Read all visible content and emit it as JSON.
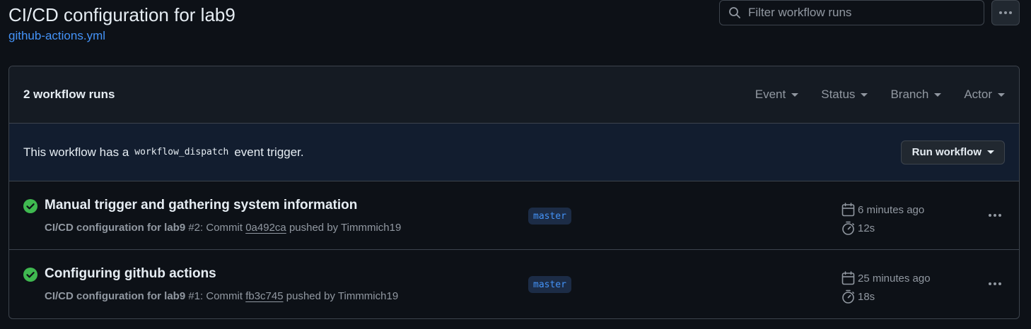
{
  "header": {
    "title": "CI/CD configuration for lab9",
    "file_link": "github-actions.yml"
  },
  "search": {
    "placeholder": "Filter workflow runs",
    "value": ""
  },
  "runs_box": {
    "count_label": "2 workflow runs",
    "filters": [
      "Event",
      "Status",
      "Branch",
      "Actor"
    ]
  },
  "dispatch": {
    "prefix": "This workflow has a",
    "code": "workflow_dispatch",
    "suffix": "event trigger.",
    "button_label": "Run workflow"
  },
  "runs": [
    {
      "title": "Manual trigger and gathering system information",
      "workflow": "CI/CD configuration for lab9",
      "run_number": "#2",
      "commit_prefix": ": Commit",
      "commit_sha": "0a492ca",
      "pushed_by": "pushed by Timmmich19",
      "branch": "master",
      "time_ago": "6 minutes ago",
      "duration": "12s",
      "status": "success"
    },
    {
      "title": "Configuring github actions",
      "workflow": "CI/CD configuration for lab9",
      "run_number": "#1",
      "commit_prefix": ": Commit",
      "commit_sha": "fb3c745",
      "pushed_by": "pushed by Timmmich19",
      "branch": "master",
      "time_ago": "25 minutes ago",
      "duration": "18s",
      "status": "success"
    }
  ],
  "colors": {
    "background": "#0d1117",
    "link": "#4493f8",
    "success": "#3fb950",
    "muted": "#9198a1"
  }
}
